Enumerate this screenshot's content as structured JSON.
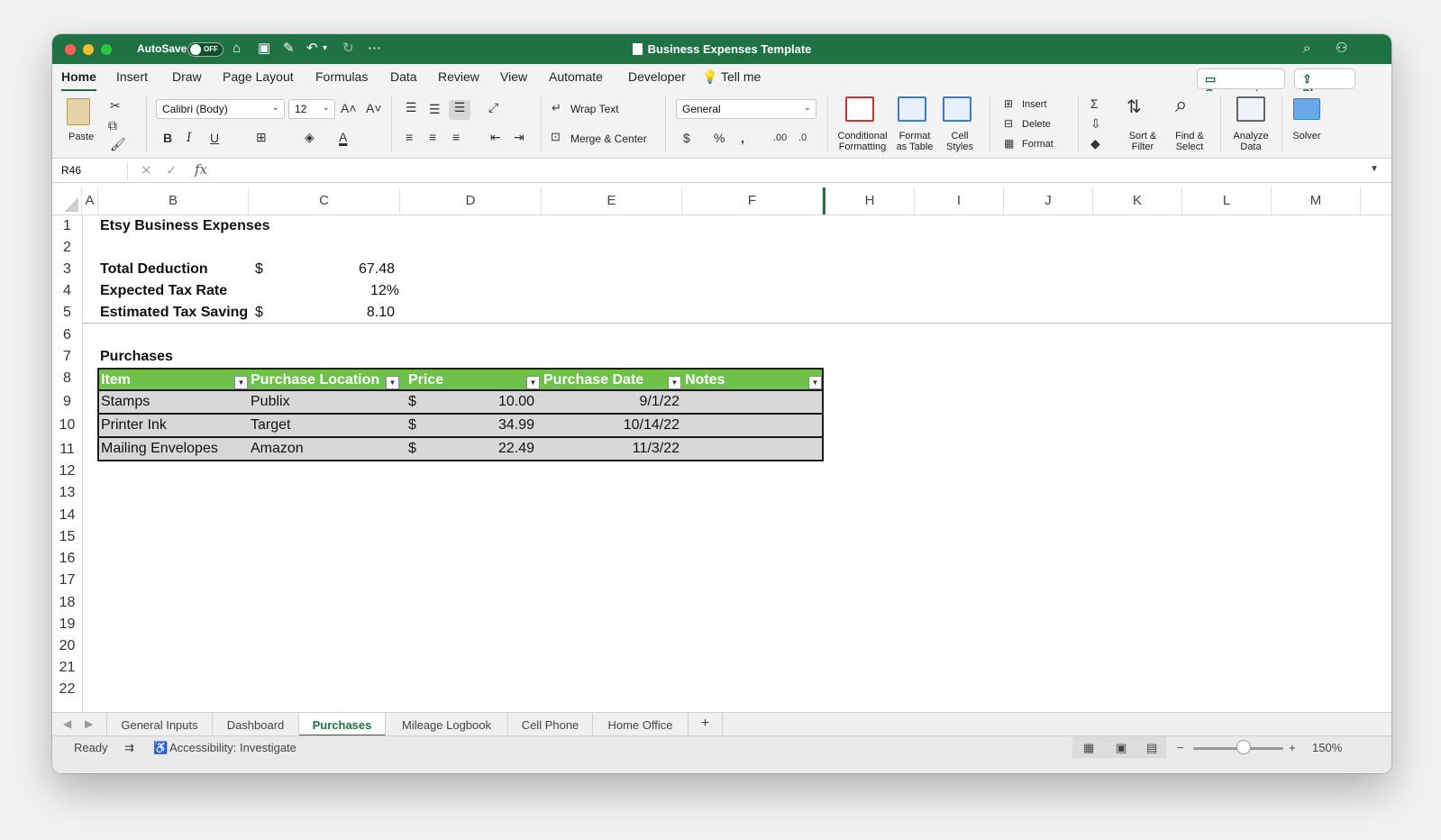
{
  "titlebar": {
    "autosave_label": "AutoSave",
    "autosave_state": "OFF",
    "document_title": "Business Expenses Template"
  },
  "menu": {
    "tabs": [
      "Home",
      "Insert",
      "Draw",
      "Page Layout",
      "Formulas",
      "Data",
      "Review",
      "View",
      "Automate",
      "Developer"
    ],
    "active_tab": "Home",
    "tell_me": "Tell me",
    "comments_label": "Comments",
    "share_label": "Share"
  },
  "ribbon": {
    "paste_label": "Paste",
    "font_name": "Calibri (Body)",
    "font_size": "12",
    "wrap_text_label": "Wrap Text",
    "merge_center_label": "Merge & Center",
    "number_format": "General",
    "conditional_formatting_label": "Conditional Formatting",
    "format_as_table_label": "Format as Table",
    "cell_styles_label": "Cell Styles",
    "insert_label": "Insert",
    "delete_label": "Delete",
    "format_label": "Format",
    "sort_filter_label": "Sort & Filter",
    "find_select_label": "Find & Select",
    "analyze_data_label": "Analyze Data",
    "solver_label": "Solver"
  },
  "formula_bar": {
    "name_box": "R46",
    "fx": "fx",
    "content": ""
  },
  "columns": [
    "A",
    "B",
    "C",
    "D",
    "E",
    "F",
    "H",
    "I",
    "J",
    "K",
    "L",
    "M"
  ],
  "rows": [
    "1",
    "2",
    "3",
    "4",
    "5",
    "6",
    "7",
    "8",
    "9",
    "10",
    "11",
    "12",
    "13",
    "14",
    "15",
    "16",
    "17",
    "18",
    "19",
    "20",
    "21",
    "22"
  ],
  "sheet": {
    "title": "Etsy Business Expenses",
    "total_deduction_label": "Total Deduction",
    "total_deduction_currency": "$",
    "total_deduction_value": "67.48",
    "expected_tax_rate_label": "Expected Tax Rate",
    "expected_tax_rate_value": "12%",
    "estimated_tax_savings_label": "Estimated Tax Saving:",
    "estimated_tax_savings_currency": "$",
    "estimated_tax_savings_value": "8.10",
    "purchases_heading": "Purchases",
    "table": {
      "headers": [
        "Item",
        "Purchase Location",
        "Price",
        "Purchase Date",
        "Notes"
      ],
      "rows": [
        {
          "item": "Stamps",
          "location": "Publix",
          "currency": "$",
          "price": "10.00",
          "date": "9/1/22",
          "notes": ""
        },
        {
          "item": "Printer Ink",
          "location": "Target",
          "currency": "$",
          "price": "34.99",
          "date": "10/14/22",
          "notes": ""
        },
        {
          "item": "Mailing Envelopes",
          "location": "Amazon",
          "currency": "$",
          "price": "22.49",
          "date": "11/3/22",
          "notes": ""
        }
      ]
    }
  },
  "sheet_tabs": [
    "General Inputs",
    "Dashboard",
    "Purchases",
    "Mileage Logbook",
    "Cell Phone",
    "Home Office"
  ],
  "active_sheet": "Purchases",
  "status": {
    "ready": "Ready",
    "accessibility": "Accessibility: Investigate",
    "zoom": "150%"
  },
  "colors": {
    "brand_green": "#207245",
    "table_header": "#6cc24a",
    "table_row": "#d8d8d8"
  }
}
